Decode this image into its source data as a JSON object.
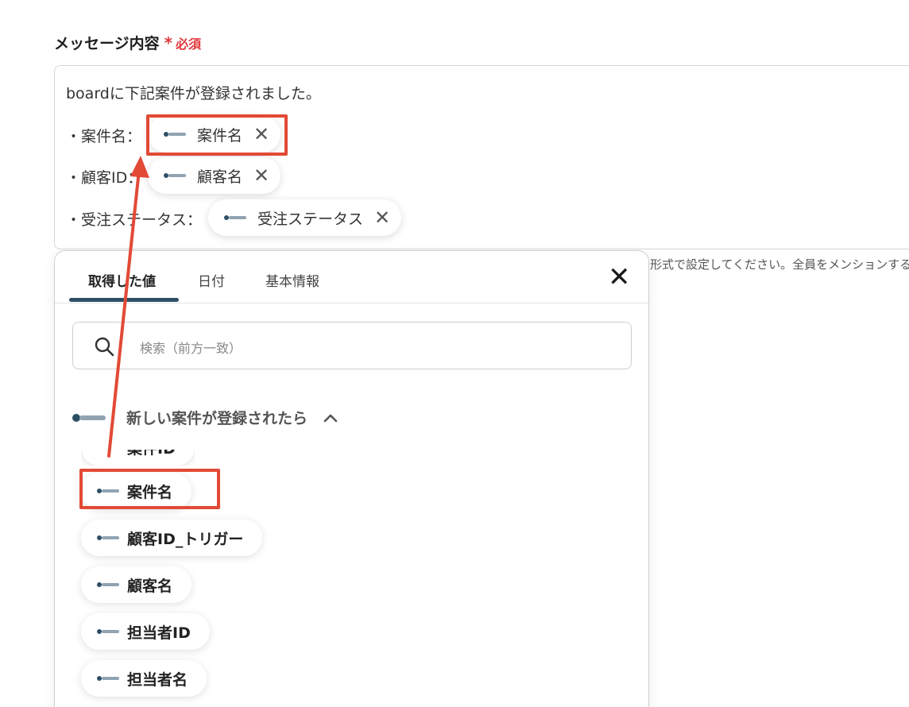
{
  "field": {
    "label": "メッセージ内容",
    "required_mark": "*",
    "required_text": "必須"
  },
  "message": {
    "intro": "boardに下記案件が登録されました。",
    "rows": [
      {
        "label": "・案件名：",
        "chip": "案件名"
      },
      {
        "label": "・顧客ID：",
        "chip": "顧客名"
      },
      {
        "label": "・受注ステータス：",
        "chip": "受注ステータス"
      }
    ]
  },
  "chip_close_glyph": "✕",
  "helper_text": "形式で設定してください。全員をメンションする",
  "popup": {
    "tabs": [
      {
        "label": "取得した値",
        "active": true
      },
      {
        "label": "日付",
        "active": false
      },
      {
        "label": "基本情報",
        "active": false
      }
    ],
    "close_glyph": "✕",
    "search_placeholder": "検索（前方一致）",
    "group": {
      "logo_icon": "board-logo-icon",
      "title": "新しい案件が登録されたら",
      "expanded": true
    },
    "items": [
      {
        "label": "案件ID"
      },
      {
        "label": "案件名"
      },
      {
        "label": "顧客ID_トリガー"
      },
      {
        "label": "顧客名"
      },
      {
        "label": "担当者ID"
      },
      {
        "label": "担当者名"
      }
    ]
  },
  "highlight_color": "#e24a36",
  "accent_color": "#2d4f66"
}
